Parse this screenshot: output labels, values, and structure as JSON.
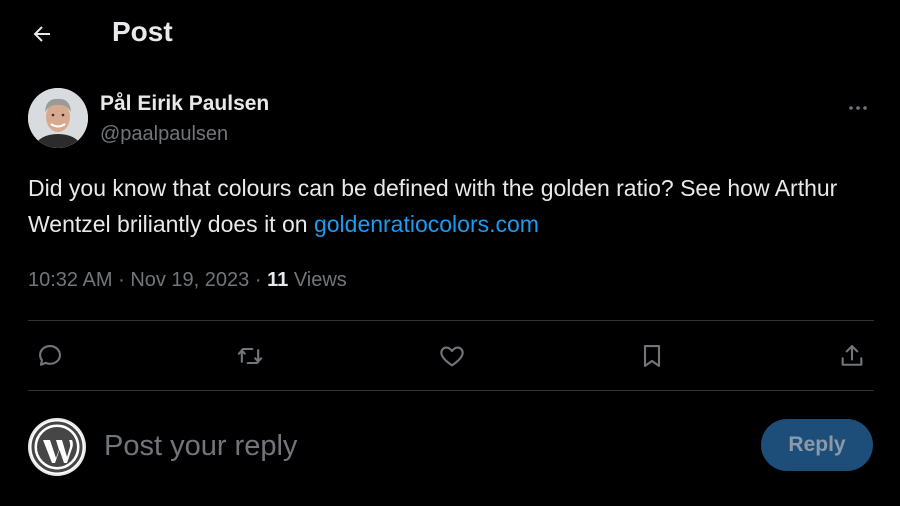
{
  "header": {
    "title": "Post",
    "back_icon": "arrow-left-icon"
  },
  "post": {
    "author": {
      "name": "Pål Eirik Paulsen",
      "handle": "@paalpaulsen"
    },
    "text_before_link": "Did you know that colours can be defined with the golden ratio? See how Arthur Wentzel briliantly does it on ",
    "link_text": "goldenratiocolors.com",
    "time": "10:32 AM",
    "separator": "·",
    "date": "Nov 19, 2023",
    "views_count": "11",
    "views_label": "Views"
  },
  "actions": {
    "reply_icon": "comment-icon",
    "repost_icon": "repost-icon",
    "like_icon": "heart-icon",
    "bookmark_icon": "bookmark-icon",
    "share_icon": "share-icon"
  },
  "composer": {
    "placeholder": "Post your reply",
    "reply_label": "Reply"
  },
  "colors": {
    "background": "#000000",
    "text_primary": "#e7e9ea",
    "text_secondary": "#71767b",
    "link": "#1d9bf0",
    "divider": "#2f3336",
    "reply_button_bg": "#1d4e7a"
  }
}
